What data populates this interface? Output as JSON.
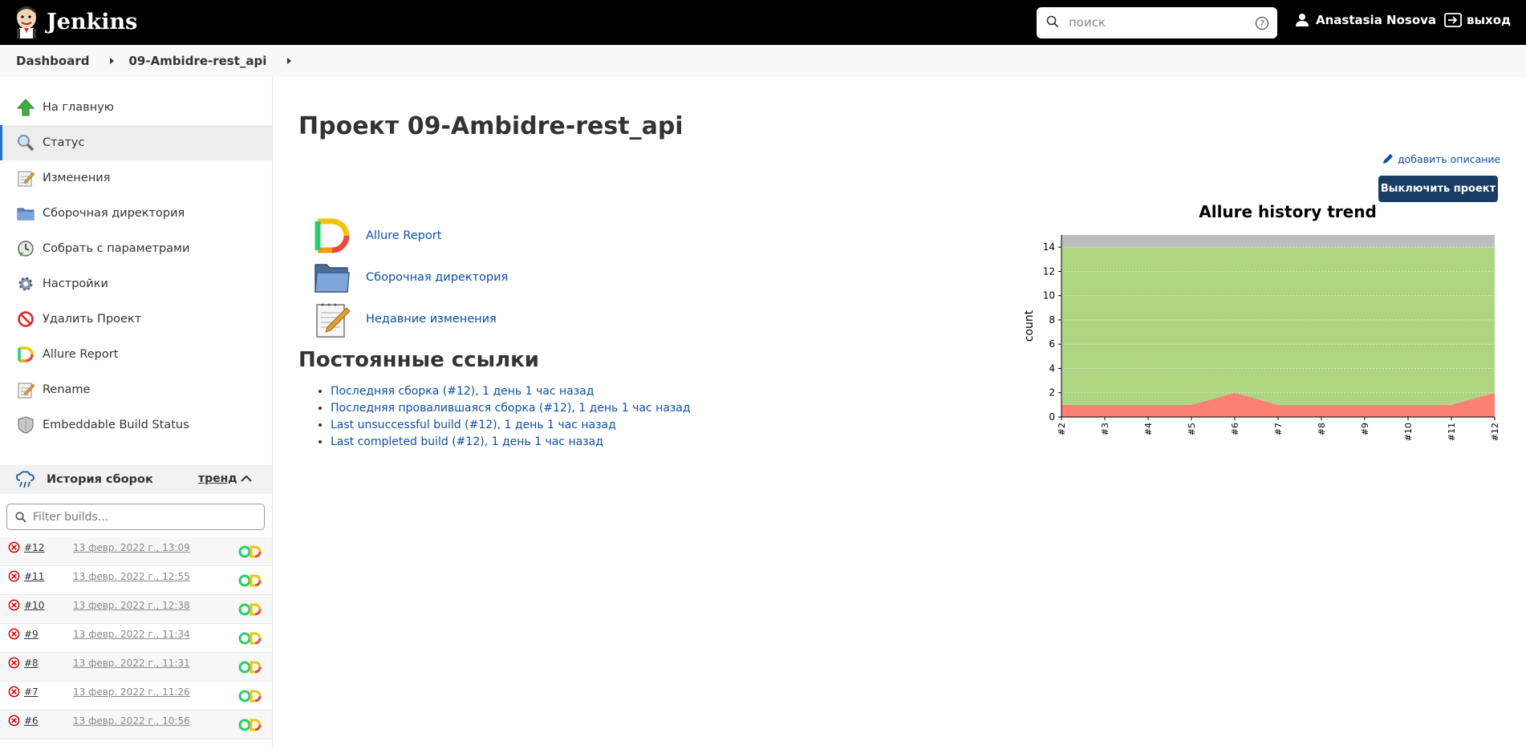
{
  "header": {
    "app_name": "Jenkins",
    "search_placeholder": "поиск",
    "user_name": "Anastasia Nosova",
    "logout_label": "выход"
  },
  "breadcrumb": {
    "items": [
      "Dashboard",
      "09-Ambidre-rest_api"
    ]
  },
  "sidebar": {
    "items": [
      {
        "label": "На главную",
        "icon": "up-arrow-icon"
      },
      {
        "label": "Статус",
        "icon": "magnifier-icon",
        "active": true
      },
      {
        "label": "Изменения",
        "icon": "notepad-icon"
      },
      {
        "label": "Сборочная директория",
        "icon": "folder-icon"
      },
      {
        "label": "Собрать с параметрами",
        "icon": "clock-icon"
      },
      {
        "label": "Настройки",
        "icon": "gear-icon"
      },
      {
        "label": "Удалить Проект",
        "icon": "no-entry-icon"
      },
      {
        "label": "Allure Report",
        "icon": "allure-icon"
      },
      {
        "label": "Rename",
        "icon": "notepad-icon"
      },
      {
        "label": "Embeddable Build Status",
        "icon": "shield-icon"
      }
    ]
  },
  "build_history": {
    "title": "История сборок",
    "trend_label": "тренд",
    "filter_placeholder": "Filter builds...",
    "builds": [
      {
        "number": "#12",
        "date": "13 февр. 2022 г., 13:09"
      },
      {
        "number": "#11",
        "date": "13 февр. 2022 г., 12:55"
      },
      {
        "number": "#10",
        "date": "13 февр. 2022 г., 12:38"
      },
      {
        "number": "#9",
        "date": "13 февр. 2022 г., 11:34"
      },
      {
        "number": "#8",
        "date": "13 февр. 2022 г., 11:31"
      },
      {
        "number": "#7",
        "date": "13 февр. 2022 г., 11:26"
      },
      {
        "number": "#6",
        "date": "13 февр. 2022 г., 10:56"
      }
    ],
    "status_color": "#cc0000"
  },
  "main": {
    "title": "Проект 09-Ambidre-rest_api",
    "add_description": "добавить описание",
    "disable_button": "Выключить проект",
    "links": [
      {
        "label": "Allure Report",
        "icon": "allure-icon"
      },
      {
        "label": "Сборочная директория",
        "icon": "folder-icon"
      },
      {
        "label": "Недавние изменения",
        "icon": "notepad-icon"
      }
    ],
    "permalinks_title": "Постоянные ссылки",
    "permalinks": [
      "Последняя сборка (#12), 1 день 1 час назад",
      "Последняя провалившаяся сборка (#12), 1 день 1 час назад",
      "Last unsuccessful build (#12), 1 день 1 час назад",
      "Last completed build (#12), 1 день 1 час назад"
    ]
  },
  "chart_data": {
    "type": "area",
    "title": "Allure history trend",
    "ylabel": "count",
    "xlabel": "",
    "ylim": [
      0,
      15
    ],
    "yticks": [
      0,
      2,
      4,
      6,
      8,
      10,
      12,
      14
    ],
    "categories": [
      "#2",
      "#3",
      "#4",
      "#5",
      "#6",
      "#7",
      "#8",
      "#9",
      "#10",
      "#11",
      "#12"
    ],
    "stacked": true,
    "grid": true,
    "series": [
      {
        "color": "#fd8075",
        "values": [
          1,
          1,
          1,
          1,
          2,
          1,
          1,
          1,
          1,
          1,
          2
        ]
      },
      {
        "color": "#aed581",
        "values": [
          13,
          13,
          13,
          13,
          12,
          13,
          13,
          13,
          13,
          13,
          12
        ]
      },
      {
        "color": "#bdbdbd",
        "values": [
          1,
          1,
          1,
          1,
          1,
          1,
          1,
          1,
          1,
          1,
          1
        ]
      }
    ]
  }
}
